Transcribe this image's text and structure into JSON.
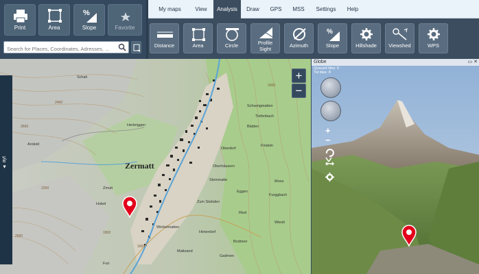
{
  "left_toolbar": {
    "buttons": [
      {
        "label": "Print",
        "icon": "printer-icon"
      },
      {
        "label": "Area",
        "icon": "area-icon"
      },
      {
        "label": "Slope",
        "icon": "slope-icon"
      },
      {
        "label": "Favorite",
        "icon": "star-icon"
      }
    ],
    "search": {
      "placeholder": "Search for Places, Coordinates, Adresses, ..."
    }
  },
  "menu": {
    "tabs": [
      "My maps",
      "View",
      "Analysis",
      "Draw",
      "GPS",
      "MSS",
      "Settings",
      "Help"
    ],
    "active_tab": "Analysis",
    "tools": [
      {
        "label": "Distance",
        "icon": "distance-icon"
      },
      {
        "label": "Area",
        "icon": "area-icon"
      },
      {
        "label": "Circle",
        "icon": "circle-icon"
      },
      {
        "label": "Profile",
        "label2": "Sight",
        "icon": "profile-icon"
      },
      {
        "label": "Azimuth",
        "icon": "azimuth-icon"
      },
      {
        "label": "Slope",
        "icon": "slope-icon"
      },
      {
        "label": "Hillshade",
        "icon": "gear-icon"
      },
      {
        "label": "Viewshed",
        "icon": "viewshed-icon"
      },
      {
        "label": "WPS",
        "icon": "gear-icon"
      }
    ]
  },
  "side_strip": {
    "label": "▲ ayt"
  },
  "map": {
    "town_label": "Zermatt",
    "places": [
      "Oberhäusern",
      "Winkelmatten",
      "Zum Stebden",
      "Bodmen",
      "Steinmatte",
      "Furi",
      "Aroleid",
      "Herbriggen",
      "Blatten",
      "Zmutt",
      "Hubel",
      "Wiesti",
      "Schweigmatten",
      "Tiefenbach",
      "Findeln",
      "Ried",
      "Moos",
      "Hinterdorf",
      "Eggen",
      "Mattsand",
      "Oberdorf",
      "Schali",
      "Gadmen",
      "Furggbach"
    ],
    "contour_values": [
      "2400",
      "2000",
      "1800",
      "2600",
      "2200",
      "2000",
      "1600"
    ],
    "zoom_in": "+",
    "zoom_out": "−"
  },
  "globe": {
    "title": "Globe",
    "window_controls": "▭ ✕",
    "info_line1": "Queued tiles: 0",
    "info_line2": "Tot tiles: 8",
    "plus": "+",
    "minus": "−"
  },
  "colors": {
    "toolbar_bg": "#34495e",
    "tab_bg": "#eaf2fa",
    "pin": "#e3001b"
  }
}
